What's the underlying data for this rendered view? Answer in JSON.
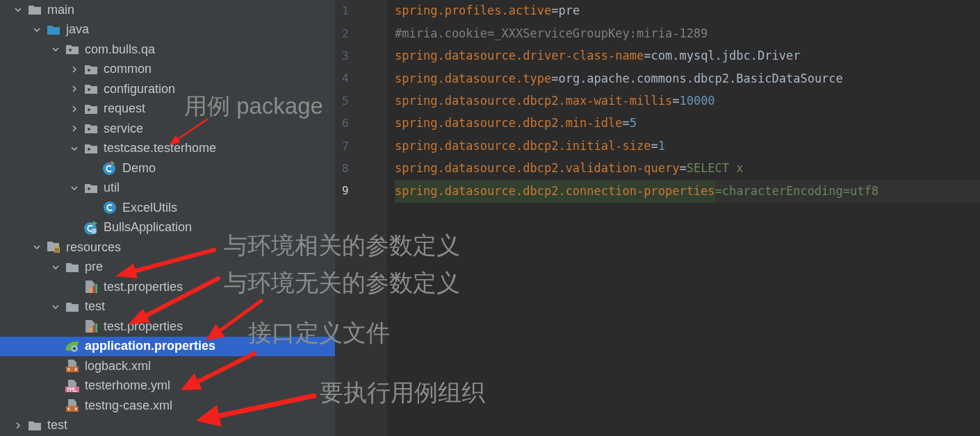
{
  "project_tree": [
    {
      "label": "main",
      "kind": "folder",
      "expanded": true,
      "selected": false,
      "children": [
        {
          "label": "java",
          "kind": "source-folder",
          "expanded": true,
          "selected": false,
          "children": [
            {
              "label": "com.bulls.qa",
              "kind": "package",
              "expanded": true,
              "selected": false,
              "children": [
                {
                  "label": "common",
                  "kind": "package",
                  "expanded": false,
                  "selected": false
                },
                {
                  "label": "configuration",
                  "kind": "package",
                  "expanded": false,
                  "selected": false
                },
                {
                  "label": "request",
                  "kind": "package",
                  "expanded": false,
                  "selected": false
                },
                {
                  "label": "service",
                  "kind": "package",
                  "expanded": false,
                  "selected": false
                },
                {
                  "label": "testcase.testerhome",
                  "kind": "package",
                  "expanded": true,
                  "selected": false,
                  "children": [
                    {
                      "label": "Demo",
                      "kind": "test-class",
                      "selected": false
                    }
                  ]
                },
                {
                  "label": "util",
                  "kind": "package",
                  "expanded": true,
                  "selected": false,
                  "children": [
                    {
                      "label": "ExcelUtils",
                      "kind": "class",
                      "selected": false
                    }
                  ]
                },
                {
                  "label": "BullsApplication",
                  "kind": "spring-class",
                  "selected": false
                }
              ]
            }
          ]
        },
        {
          "label": "resources",
          "kind": "resource-folder",
          "expanded": true,
          "selected": false,
          "children": [
            {
              "label": "pre",
              "kind": "folder",
              "expanded": true,
              "selected": false,
              "children": [
                {
                  "label": "test.properties",
                  "kind": "properties",
                  "selected": false
                }
              ]
            },
            {
              "label": "test",
              "kind": "folder",
              "expanded": true,
              "selected": false,
              "children": [
                {
                  "label": "test.properties",
                  "kind": "properties",
                  "selected": false
                }
              ]
            },
            {
              "label": "application.properties",
              "kind": "spring-properties",
              "selected": true
            },
            {
              "label": "logback.xml",
              "kind": "xml",
              "selected": false
            },
            {
              "label": "testerhome.yml",
              "kind": "yml",
              "selected": false
            },
            {
              "label": "testng-case.xml",
              "kind": "xml",
              "selected": false
            }
          ]
        }
      ]
    },
    {
      "label": "test",
      "kind": "folder",
      "expanded": false,
      "selected": false
    }
  ],
  "editor": {
    "lines": [
      {
        "number": "1",
        "current": false,
        "tokens": [
          {
            "text": "spring.profiles.active",
            "kind": "key"
          },
          {
            "text": "=",
            "kind": "sep"
          },
          {
            "text": "pre",
            "kind": "value"
          }
        ]
      },
      {
        "number": "2",
        "current": false,
        "tokens": [
          {
            "text": "#miria.cookie=_XXXServiceGroupKey:miria-1289",
            "kind": "comment"
          }
        ]
      },
      {
        "number": "3",
        "current": false,
        "tokens": [
          {
            "text": "spring.datasource.driver-class-name",
            "kind": "key"
          },
          {
            "text": "=",
            "kind": "sep"
          },
          {
            "text": "com.mysql.jdbc.Driver",
            "kind": "value"
          }
        ]
      },
      {
        "number": "4",
        "current": false,
        "tokens": [
          {
            "text": "spring.datasource.type",
            "kind": "key"
          },
          {
            "text": "=",
            "kind": "sep"
          },
          {
            "text": "org.apache.commons.dbcp2.BasicDataSource",
            "kind": "value"
          }
        ]
      },
      {
        "number": "5",
        "current": false,
        "tokens": [
          {
            "text": "spring.datasource.dbcp2.max-wait-millis",
            "kind": "key"
          },
          {
            "text": "=",
            "kind": "sep"
          },
          {
            "text": "10000",
            "kind": "number"
          }
        ]
      },
      {
        "number": "6",
        "current": false,
        "tokens": [
          {
            "text": "spring.datasource.dbcp2.min-idle",
            "kind": "key"
          },
          {
            "text": "=",
            "kind": "sep"
          },
          {
            "text": "5",
            "kind": "number"
          }
        ]
      },
      {
        "number": "7",
        "current": false,
        "tokens": [
          {
            "text": "spring.datasource.dbcp2.initial-size",
            "kind": "key"
          },
          {
            "text": "=",
            "kind": "sep"
          },
          {
            "text": "1",
            "kind": "number"
          }
        ]
      },
      {
        "number": "8",
        "current": false,
        "tokens": [
          {
            "text": "spring.datasource.dbcp2.validation-query",
            "kind": "key"
          },
          {
            "text": "=",
            "kind": "sep"
          },
          {
            "text": "SELECT x",
            "kind": "string"
          }
        ]
      },
      {
        "number": "9",
        "current": true,
        "tokens": [
          {
            "text": "spring.datasource.dbcp2.connection-properties",
            "kind": "key-highlight"
          },
          {
            "text": "=characterEncoding=utf8",
            "kind": "string"
          }
        ]
      }
    ]
  },
  "annotations": [
    "用例 package",
    "与环境相关的参数定义",
    "与环境无关的参数定义",
    "接口定义文件",
    "要执行用例组织"
  ]
}
